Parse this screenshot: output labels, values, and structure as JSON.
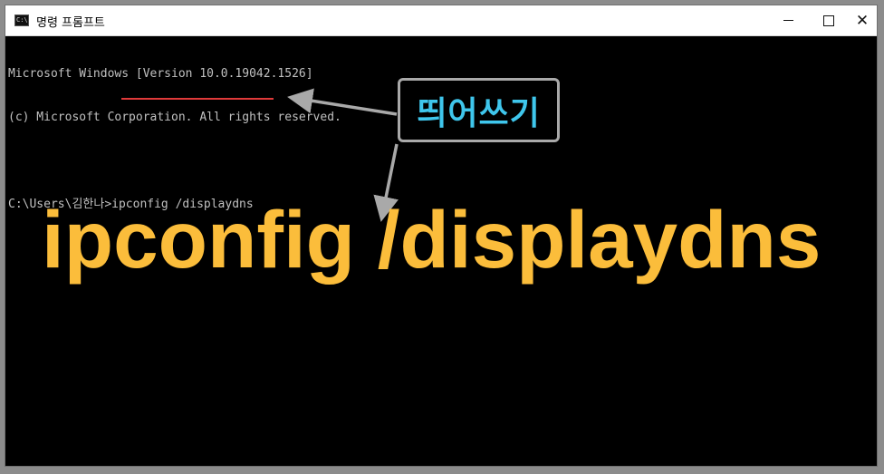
{
  "window": {
    "title": "명령 프롬프트",
    "app_icon_text": "C:\\",
    "controls": {
      "minimize": "minimize",
      "maximize": "maximize",
      "close": "✕"
    }
  },
  "console": {
    "lines": [
      "Microsoft Windows [Version 10.0.19042.1526]",
      "(c) Microsoft Corporation. All rights reserved.",
      "",
      "C:\\Users\\김한나>ipconfig /displaydns"
    ]
  },
  "annotation": {
    "callout_text": "띄어쓰기",
    "big_command": "ipconfig /displaydns",
    "colors": {
      "callout_text": "#3fc6ec",
      "big_command": "#fbbd3b",
      "underline": "#e03a3a",
      "arrow": "#a9a9a9"
    }
  }
}
